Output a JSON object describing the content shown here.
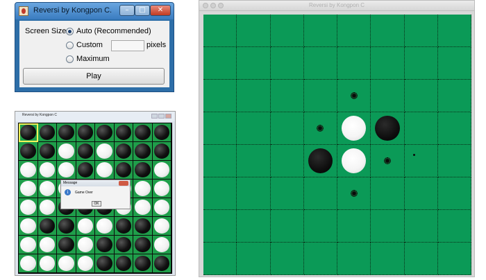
{
  "launcher": {
    "title": "Reversi by Kongpon C.",
    "screen_size_label": "Screen Size:",
    "options": [
      {
        "label": "Auto (Recommended)",
        "checked": true
      },
      {
        "label": "Custom",
        "checked": false
      },
      {
        "label": "Maximum",
        "checked": false
      }
    ],
    "pixels_label": "pixels",
    "play_label": "Play"
  },
  "gameover_window": {
    "title": "Reversi by Kongpon C",
    "selected_cell": [
      0,
      0
    ],
    "board": [
      "BBBBBBBB",
      "BBWBWBBB",
      "WWWBWBBW",
      "WWWBBWWW",
      "WWBBBWWW",
      "WBBWWBBW",
      "WWBWBBBW",
      "WWWWBBBB"
    ],
    "message": {
      "title": "Message",
      "text": "Game Over",
      "ok_label": "OK"
    }
  },
  "mac_window": {
    "title": "Reversi by Kongpon C",
    "board": [
      "........",
      "........",
      "....H...",
      "...HWB..",
      "...BWH..",
      "....H...",
      "........",
      "........"
    ]
  }
}
